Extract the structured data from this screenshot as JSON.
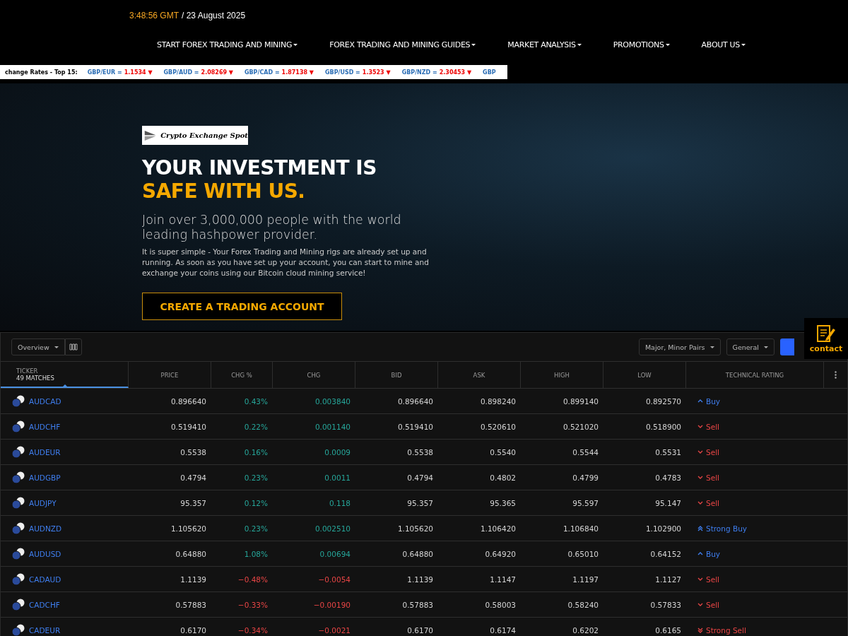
{
  "clock": {
    "time": "3:48:56 GMT",
    "date": "/ 23 August 2025"
  },
  "nav": [
    {
      "label": "START FOREX TRADING AND MINING"
    },
    {
      "label": "FOREX TRADING AND MINING GUIDES"
    },
    {
      "label": "MARKET ANALYSIS"
    },
    {
      "label": "PROMOTIONS"
    },
    {
      "label": "ABOUT US"
    }
  ],
  "rates_strip": {
    "title": "change Rates - Top 15:",
    "items": [
      {
        "pair": "GBP/EUR =",
        "value": "1.1534 ▼"
      },
      {
        "pair": "GBP/AUD =",
        "value": "2.08269 ▼"
      },
      {
        "pair": "GBP/CAD =",
        "value": "1.87138 ▼"
      },
      {
        "pair": "GBP/USD =",
        "value": "1.3523 ▼"
      },
      {
        "pair": "GBP/NZD =",
        "value": "2.30453 ▼"
      },
      {
        "pair": "GBP"
      }
    ]
  },
  "hero": {
    "logo": "Crypto Exchange Spot",
    "headline": "YOUR INVESTMENT IS",
    "headline_accent": "SAFE WITH US.",
    "subtitle": "Join over 3,000,000 people with the world leading hashpower provider.",
    "body": "It is super simple - Your Forex Trading and Mining rigs are already set up and running. As soon as you have set up your account, you can start to mine and exchange your coins using our Bitcoin cloud mining service!",
    "cta": "CREATE A TRADING ACCOUNT"
  },
  "contact": {
    "label": "contact"
  },
  "screener": {
    "view": "Overview",
    "filters": [
      "Major, Minor Pairs",
      "General"
    ],
    "columns": [
      {
        "label": "TICKER",
        "sub": "49 MATCHES"
      },
      {
        "label": "PRICE"
      },
      {
        "label": "CHG %"
      },
      {
        "label": "CHG"
      },
      {
        "label": "BID"
      },
      {
        "label": "ASK"
      },
      {
        "label": "HIGH"
      },
      {
        "label": "LOW"
      },
      {
        "label": "TECHNICAL RATING"
      }
    ],
    "rows": [
      {
        "ticker": "AUDCAD",
        "price": "0.896640",
        "chg_pct": "0.43%",
        "chg": "0.003840",
        "color": "#26a69a",
        "bid": "0.896640",
        "ask": "0.898240",
        "high": "0.899140",
        "low": "0.892570",
        "rating": "Buy",
        "kind": "buy"
      },
      {
        "ticker": "AUDCHF",
        "price": "0.519410",
        "chg_pct": "0.22%",
        "chg": "0.001140",
        "color": "#26a69a",
        "bid": "0.519410",
        "ask": "0.520610",
        "high": "0.521020",
        "low": "0.518900",
        "rating": "Sell",
        "kind": "sell"
      },
      {
        "ticker": "AUDEUR",
        "price": "0.5538",
        "chg_pct": "0.16%",
        "chg": "0.0009",
        "color": "#26a69a",
        "bid": "0.5538",
        "ask": "0.5540",
        "high": "0.5544",
        "low": "0.5531",
        "rating": "Sell",
        "kind": "sell"
      },
      {
        "ticker": "AUDGBP",
        "price": "0.4794",
        "chg_pct": "0.23%",
        "chg": "0.0011",
        "color": "#26a69a",
        "bid": "0.4794",
        "ask": "0.4802",
        "high": "0.4799",
        "low": "0.4783",
        "rating": "Sell",
        "kind": "sell"
      },
      {
        "ticker": "AUDJPY",
        "price": "95.357",
        "chg_pct": "0.12%",
        "chg": "0.118",
        "color": "#26a69a",
        "bid": "95.357",
        "ask": "95.365",
        "high": "95.597",
        "low": "95.147",
        "rating": "Sell",
        "kind": "sell"
      },
      {
        "ticker": "AUDNZD",
        "price": "1.105620",
        "chg_pct": "0.23%",
        "chg": "0.002510",
        "color": "#26a69a",
        "bid": "1.105620",
        "ask": "1.106420",
        "high": "1.106840",
        "low": "1.102900",
        "rating": "Strong Buy",
        "kind": "strong_buy"
      },
      {
        "ticker": "AUDUSD",
        "price": "0.64880",
        "chg_pct": "1.08%",
        "chg": "0.00694",
        "color": "#26a69a",
        "bid": "0.64880",
        "ask": "0.64920",
        "high": "0.65010",
        "low": "0.64152",
        "rating": "Buy",
        "kind": "buy"
      },
      {
        "ticker": "CADAUD",
        "price": "1.1139",
        "chg_pct": "−0.48%",
        "chg": "−0.0054",
        "color": "#e84545",
        "bid": "1.1139",
        "ask": "1.1147",
        "high": "1.1197",
        "low": "1.1127",
        "rating": "Sell",
        "kind": "sell"
      },
      {
        "ticker": "CADCHF",
        "price": "0.57883",
        "chg_pct": "−0.33%",
        "chg": "−0.00190",
        "color": "#e84545",
        "bid": "0.57883",
        "ask": "0.58003",
        "high": "0.58240",
        "low": "0.57833",
        "rating": "Sell",
        "kind": "sell"
      },
      {
        "ticker": "CADEUR",
        "price": "0.6170",
        "chg_pct": "−0.34%",
        "chg": "−0.0021",
        "color": "#e84545",
        "bid": "0.6170",
        "ask": "0.6174",
        "high": "0.6202",
        "low": "0.6165",
        "rating": "Strong Sell",
        "kind": "strong_sell"
      }
    ]
  }
}
